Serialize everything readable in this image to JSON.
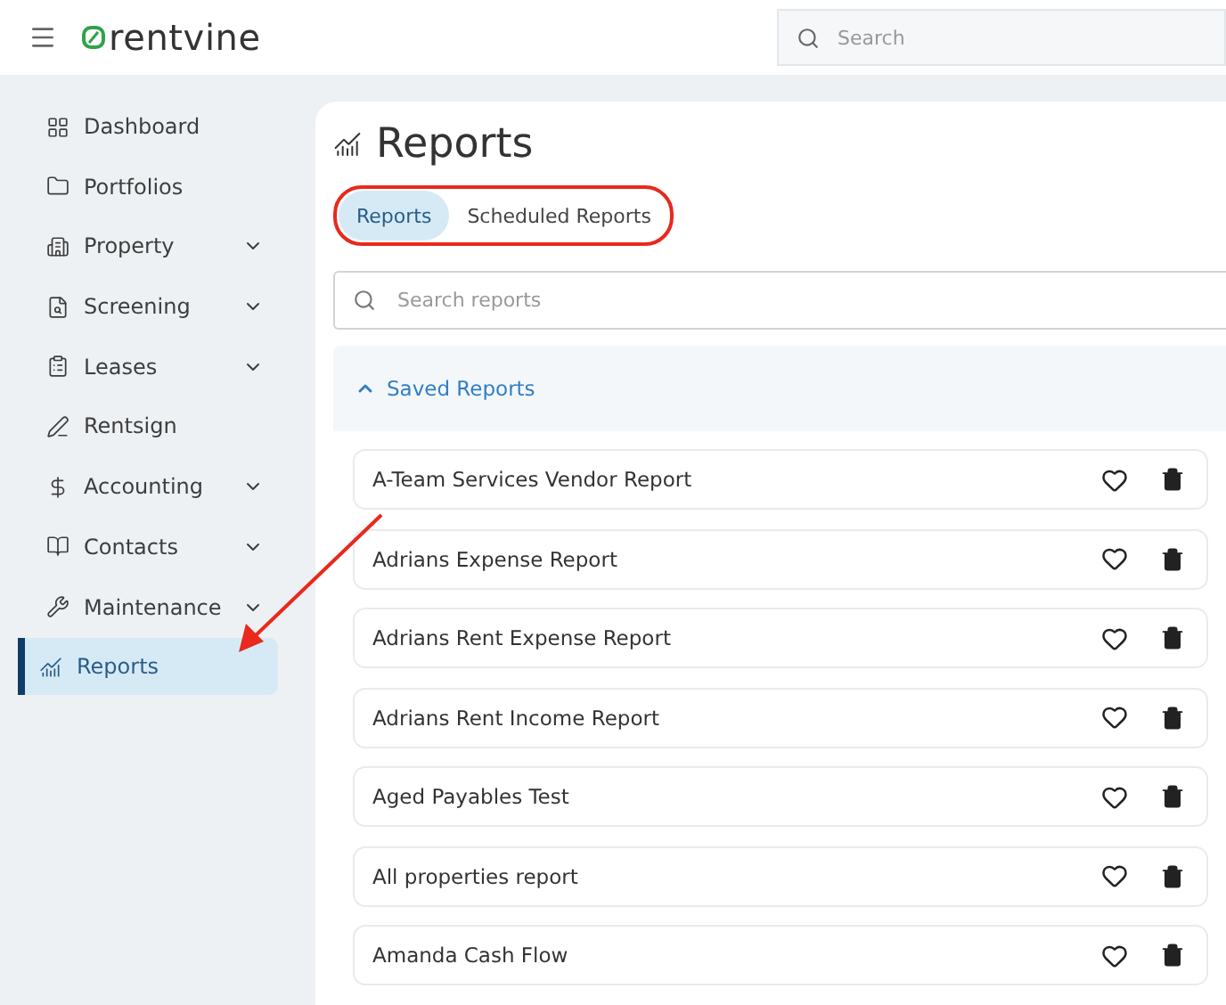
{
  "header": {
    "logo": "rentvine",
    "search": {
      "placeholder": "Search"
    }
  },
  "sidebar": {
    "items": [
      {
        "label": "Dashboard",
        "expandable": false,
        "selected": false
      },
      {
        "label": "Portfolios",
        "expandable": false,
        "selected": false
      },
      {
        "label": "Property",
        "expandable": true,
        "selected": false
      },
      {
        "label": "Screening",
        "expandable": true,
        "selected": false
      },
      {
        "label": "Leases",
        "expandable": true,
        "selected": false
      },
      {
        "label": "Rentsign",
        "expandable": false,
        "selected": false
      },
      {
        "label": "Accounting",
        "expandable": true,
        "selected": false
      },
      {
        "label": "Contacts",
        "expandable": true,
        "selected": false
      },
      {
        "label": "Maintenance",
        "expandable": true,
        "selected": false
      },
      {
        "label": "Reports",
        "expandable": false,
        "selected": true
      }
    ]
  },
  "page": {
    "title": "Reports",
    "tabs": [
      {
        "label": "Reports",
        "selected": true
      },
      {
        "label": "Scheduled Reports",
        "selected": false
      }
    ],
    "search": {
      "placeholder": "Search reports"
    },
    "section": {
      "title": "Saved Reports",
      "expanded": true
    },
    "reports": [
      {
        "name": "A-Team Services Vendor Report"
      },
      {
        "name": "Adrians Expense Report"
      },
      {
        "name": "Adrians Rent Expense Report"
      },
      {
        "name": "Adrians Rent Income Report"
      },
      {
        "name": "Aged Payables Test"
      },
      {
        "name": "All properties report"
      },
      {
        "name": "Amanda Cash Flow"
      }
    ]
  }
}
